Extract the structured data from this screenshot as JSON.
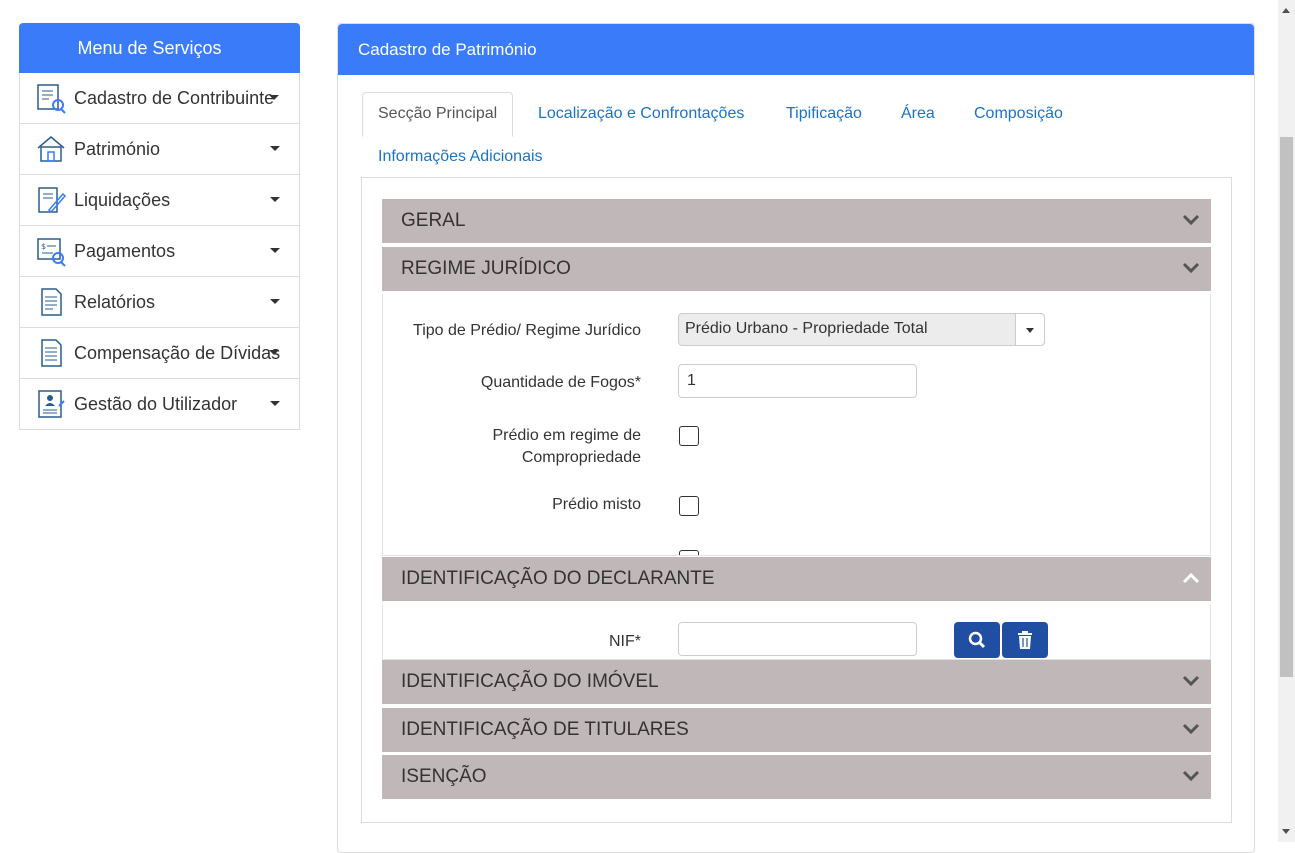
{
  "sidebar": {
    "title": "Menu de Serviços",
    "items": [
      {
        "label": "Cadastro de Contribuinte",
        "icon": "taxpayer-search-icon"
      },
      {
        "label": "Património",
        "icon": "house-icon"
      },
      {
        "label": "Liquidações",
        "icon": "document-edit-icon"
      },
      {
        "label": "Pagamentos",
        "icon": "payment-search-icon"
      },
      {
        "label": "Relatórios",
        "icon": "report-document-icon"
      },
      {
        "label": "Compensação de Dívidas",
        "icon": "document-list-icon"
      },
      {
        "label": "Gestão do Utilizador",
        "icon": "user-document-icon"
      }
    ]
  },
  "main": {
    "title": "Cadastro de Património",
    "tabs": [
      {
        "label": "Secção Principal",
        "active": true
      },
      {
        "label": "Localização e Confrontações"
      },
      {
        "label": "Tipificação"
      },
      {
        "label": "Área"
      },
      {
        "label": "Composição"
      },
      {
        "label": "Informações Adicionais"
      }
    ],
    "sections": {
      "geral": {
        "title": "GERAL",
        "expanded": false
      },
      "regime": {
        "title": "REGIME JURÍDICO",
        "expanded": true,
        "fields": {
          "tipo_label": "Tipo de Prédio/ Regime Jurídico",
          "tipo_value": "Prédio Urbano - Propriedade Total",
          "fogos_label": "Quantidade de Fogos*",
          "fogos_value": "1",
          "compropriedade_label_line1": "Prédio em regime de",
          "compropriedade_label_line2": "Compropriedade",
          "misto_label": "Prédio misto"
        }
      },
      "declarante": {
        "title": "IDENTIFICAÇÃO DO DECLARANTE",
        "expanded": true,
        "fields": {
          "nif_label": "NIF*",
          "nif_value": ""
        }
      },
      "imovel": {
        "title": "IDENTIFICAÇÃO DO IMÓVEL",
        "expanded": false
      },
      "titulares": {
        "title": "IDENTIFICAÇÃO DE TITULARES",
        "expanded": false
      },
      "isencao": {
        "title": "ISENÇÃO",
        "expanded": false
      }
    }
  },
  "colors": {
    "primary": "#3a7bfa",
    "accordion": "#c0b8b8",
    "button": "#1f4ea3",
    "link": "#1a73c8"
  }
}
